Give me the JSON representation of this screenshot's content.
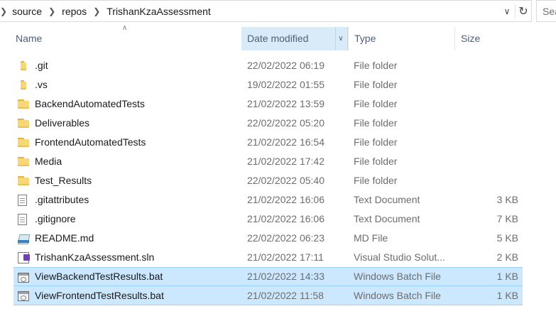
{
  "address_bar": {
    "breadcrumbs": [
      "source",
      "repos",
      "TrishanKzaAssessment"
    ],
    "separator_icon": "chevron-right-icon",
    "dropdown_icon": "chevron-down-icon",
    "refresh_icon": "refresh-icon",
    "search_placeholder": "Sea"
  },
  "columns": {
    "name": "Name",
    "date": "Date modified",
    "type": "Type",
    "size": "Size",
    "sorted_by": "Date modified"
  },
  "files": [
    {
      "icon": "folder-icon",
      "name": ".git",
      "date": "22/02/2022 06:19",
      "type": "File folder",
      "size": "",
      "selected": false
    },
    {
      "icon": "folder-icon",
      "name": ".vs",
      "date": "19/02/2022 01:55",
      "type": "File folder",
      "size": "",
      "selected": false
    },
    {
      "icon": "folder-icon",
      "name": "BackendAutomatedTests",
      "date": "21/02/2022 13:59",
      "type": "File folder",
      "size": "",
      "selected": false
    },
    {
      "icon": "folder-icon",
      "name": "Deliverables",
      "date": "22/02/2022 05:20",
      "type": "File folder",
      "size": "",
      "selected": false
    },
    {
      "icon": "folder-icon",
      "name": "FrontendAutomatedTests",
      "date": "21/02/2022 16:54",
      "type": "File folder",
      "size": "",
      "selected": false
    },
    {
      "icon": "folder-icon",
      "name": "Media",
      "date": "21/02/2022 17:42",
      "type": "File folder",
      "size": "",
      "selected": false
    },
    {
      "icon": "folder-icon",
      "name": "Test_Results",
      "date": "22/02/2022 05:40",
      "type": "File folder",
      "size": "",
      "selected": false
    },
    {
      "icon": "text-document-icon",
      "name": ".gitattributes",
      "date": "21/02/2022 16:06",
      "type": "Text Document",
      "size": "3 KB",
      "selected": false
    },
    {
      "icon": "text-document-icon",
      "name": ".gitignore",
      "date": "21/02/2022 16:06",
      "type": "Text Document",
      "size": "7 KB",
      "selected": false
    },
    {
      "icon": "markdown-file-icon",
      "name": "README.md",
      "date": "22/02/2022 06:23",
      "type": "MD File",
      "size": "5 KB",
      "selected": false
    },
    {
      "icon": "visual-studio-solution-icon",
      "name": "TrishanKzaAssessment.sln",
      "date": "21/02/2022 17:11",
      "type": "Visual Studio Solut...",
      "size": "2 KB",
      "selected": false
    },
    {
      "icon": "batch-file-icon",
      "name": "ViewBackendTestResults.bat",
      "date": "21/02/2022 14:33",
      "type": "Windows Batch File",
      "size": "1 KB",
      "selected": true
    },
    {
      "icon": "batch-file-icon",
      "name": "ViewFrontendTestResults.bat",
      "date": "21/02/2022 11:58",
      "type": "Windows Batch File",
      "size": "1 KB",
      "selected": true
    }
  ],
  "colors": {
    "selection_bg": "#cce8ff",
    "selection_border": "#99d1ff",
    "header_text": "#4c607a",
    "sorted_header_bg": "#d9ebf9"
  }
}
